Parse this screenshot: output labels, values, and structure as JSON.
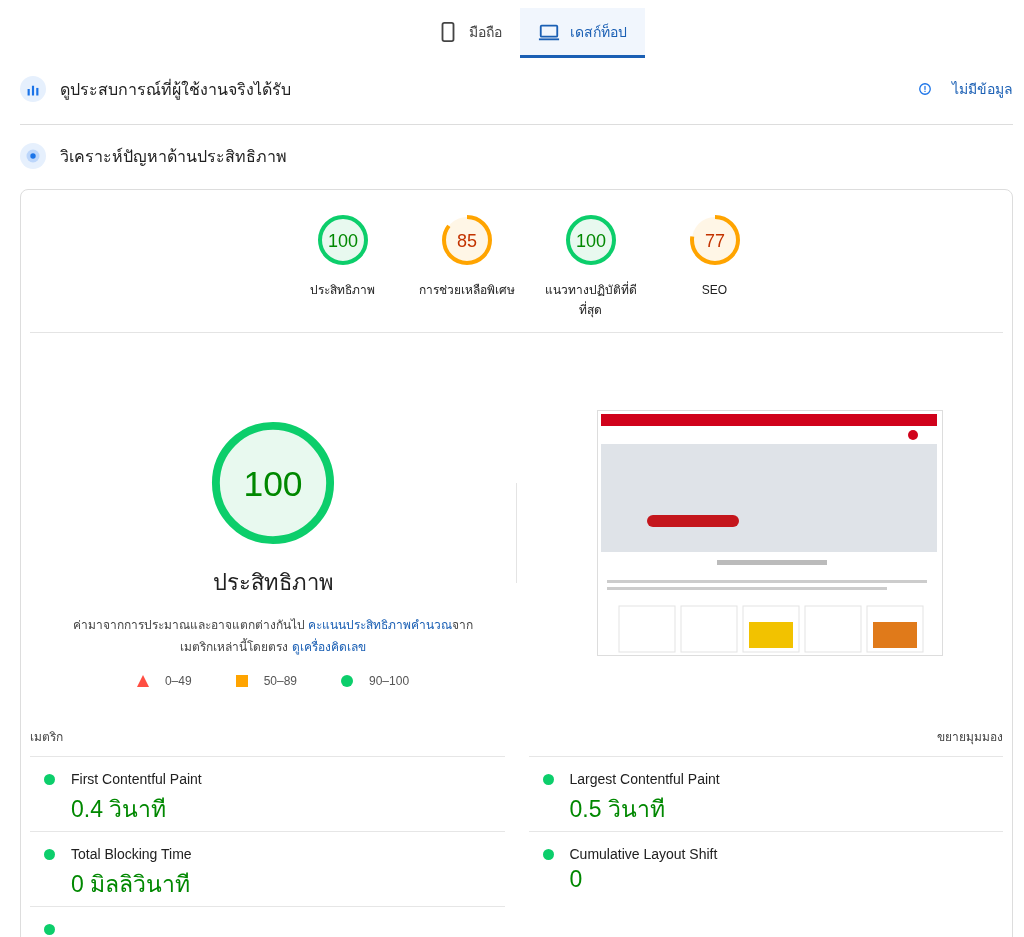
{
  "tabs": [
    {
      "label": "มือถือ",
      "kind": "phone",
      "selected": false
    },
    {
      "label": "เดสก์ท็อป",
      "kind": "laptop",
      "selected": true
    }
  ],
  "field_data": {
    "title": "ดูประสบการณ์ที่ผู้ใช้งานจริงได้รับ",
    "status": "ไม่มีข้อมูล"
  },
  "diagnose": {
    "title": "วิเคราะห์ปัญหาด้านประสิทธิภาพ"
  },
  "categories": [
    {
      "score": "100",
      "color": "#0cce6b",
      "label": "ประสิทธิภาพ"
    },
    {
      "score": "85",
      "color": "#ffa400",
      "label": "การช่วยเหลือพิเศษ"
    },
    {
      "score": "100",
      "color": "#0cce6b",
      "label": "แนวทางปฏิบัติที่ดีที่สุด"
    },
    {
      "score": "77",
      "color": "#ffa400",
      "label": "SEO"
    }
  ],
  "performance": {
    "score": "100",
    "color": "#0cce6b",
    "title": "ประสิทธิภาพ",
    "note": "ค่ามาจากการประมาณและอาจแตกต่างกันไป",
    "note_link": "คะแนนประสิทธิภาพคำนวณ",
    "note_mid": "จาก",
    "note_line2": "เมตริกเหล่านี้โดยตรง",
    "calc_link": "ดูเครื่องคิดเลข",
    "legend": [
      {
        "kind": "fail",
        "range": "0–49"
      },
      {
        "kind": "average",
        "range": "50–89"
      },
      {
        "kind": "pass",
        "range": "90–100"
      }
    ]
  },
  "metrics_header": {
    "title": "เมตริก",
    "expand": "ขยายมุมมอง"
  },
  "metrics": [
    {
      "name": "First Contentful Paint",
      "value": "0.4 วินาที",
      "color": "#0cce6b"
    },
    {
      "name": "Largest Contentful Paint",
      "value": "0.5 วินาที",
      "color": "#0cce6b"
    },
    {
      "name": "Total Blocking Time",
      "value": "0 มิลลิวินาที",
      "color": "#0cce6b"
    },
    {
      "name": "Cumulative Layout Shift",
      "value": "0",
      "color": "#0cce6b"
    },
    {
      "color": "#0cce6b"
    }
  ]
}
